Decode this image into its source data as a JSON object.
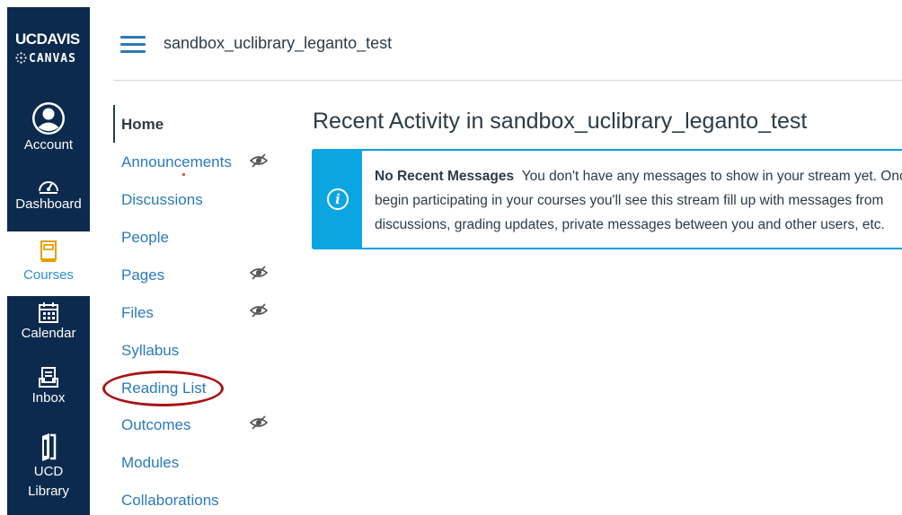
{
  "global_nav": {
    "logo_line1_a": "UC",
    "logo_line1_b": "DAVIS",
    "logo_line2": "CANVAS",
    "items": [
      {
        "label": "Account",
        "icon": "account-icon"
      },
      {
        "label": "Dashboard",
        "icon": "dashboard-icon"
      },
      {
        "label": "Courses",
        "icon": "courses-icon"
      },
      {
        "label": "Calendar",
        "icon": "calendar-icon"
      },
      {
        "label": "Inbox",
        "icon": "inbox-icon"
      },
      {
        "label": "UCD",
        "label2": "Library",
        "icon": "library-icon"
      }
    ]
  },
  "header": {
    "breadcrumb": "sandbox_uclibrary_leganto_test"
  },
  "course_nav": {
    "items": [
      {
        "label": "Home"
      },
      {
        "label": "Announcements",
        "hidden_icon": true
      },
      {
        "label": "Discussions"
      },
      {
        "label": "People"
      },
      {
        "label": "Pages",
        "hidden_icon": true
      },
      {
        "label": "Files",
        "hidden_icon": true
      },
      {
        "label": "Syllabus"
      },
      {
        "label": "Reading List"
      },
      {
        "label": "Outcomes",
        "hidden_icon": true
      },
      {
        "label": "Modules"
      },
      {
        "label": "Collaborations"
      }
    ]
  },
  "main": {
    "title": "Recent Activity in sandbox_uclibrary_leganto_test",
    "alert": {
      "heading": "No Recent Messages",
      "body": "You don't have any messages to show in your stream yet. Once you begin participating in your courses you'll see this stream fill up with messages from discussions, grading updates, private messages between you and other users, etc."
    }
  },
  "colors": {
    "nav_bg": "#0c2a4d",
    "link": "#2b7abc",
    "active": "#2d8fd0",
    "info": "#0ba6e2",
    "highlight_oval": "#a81414"
  }
}
